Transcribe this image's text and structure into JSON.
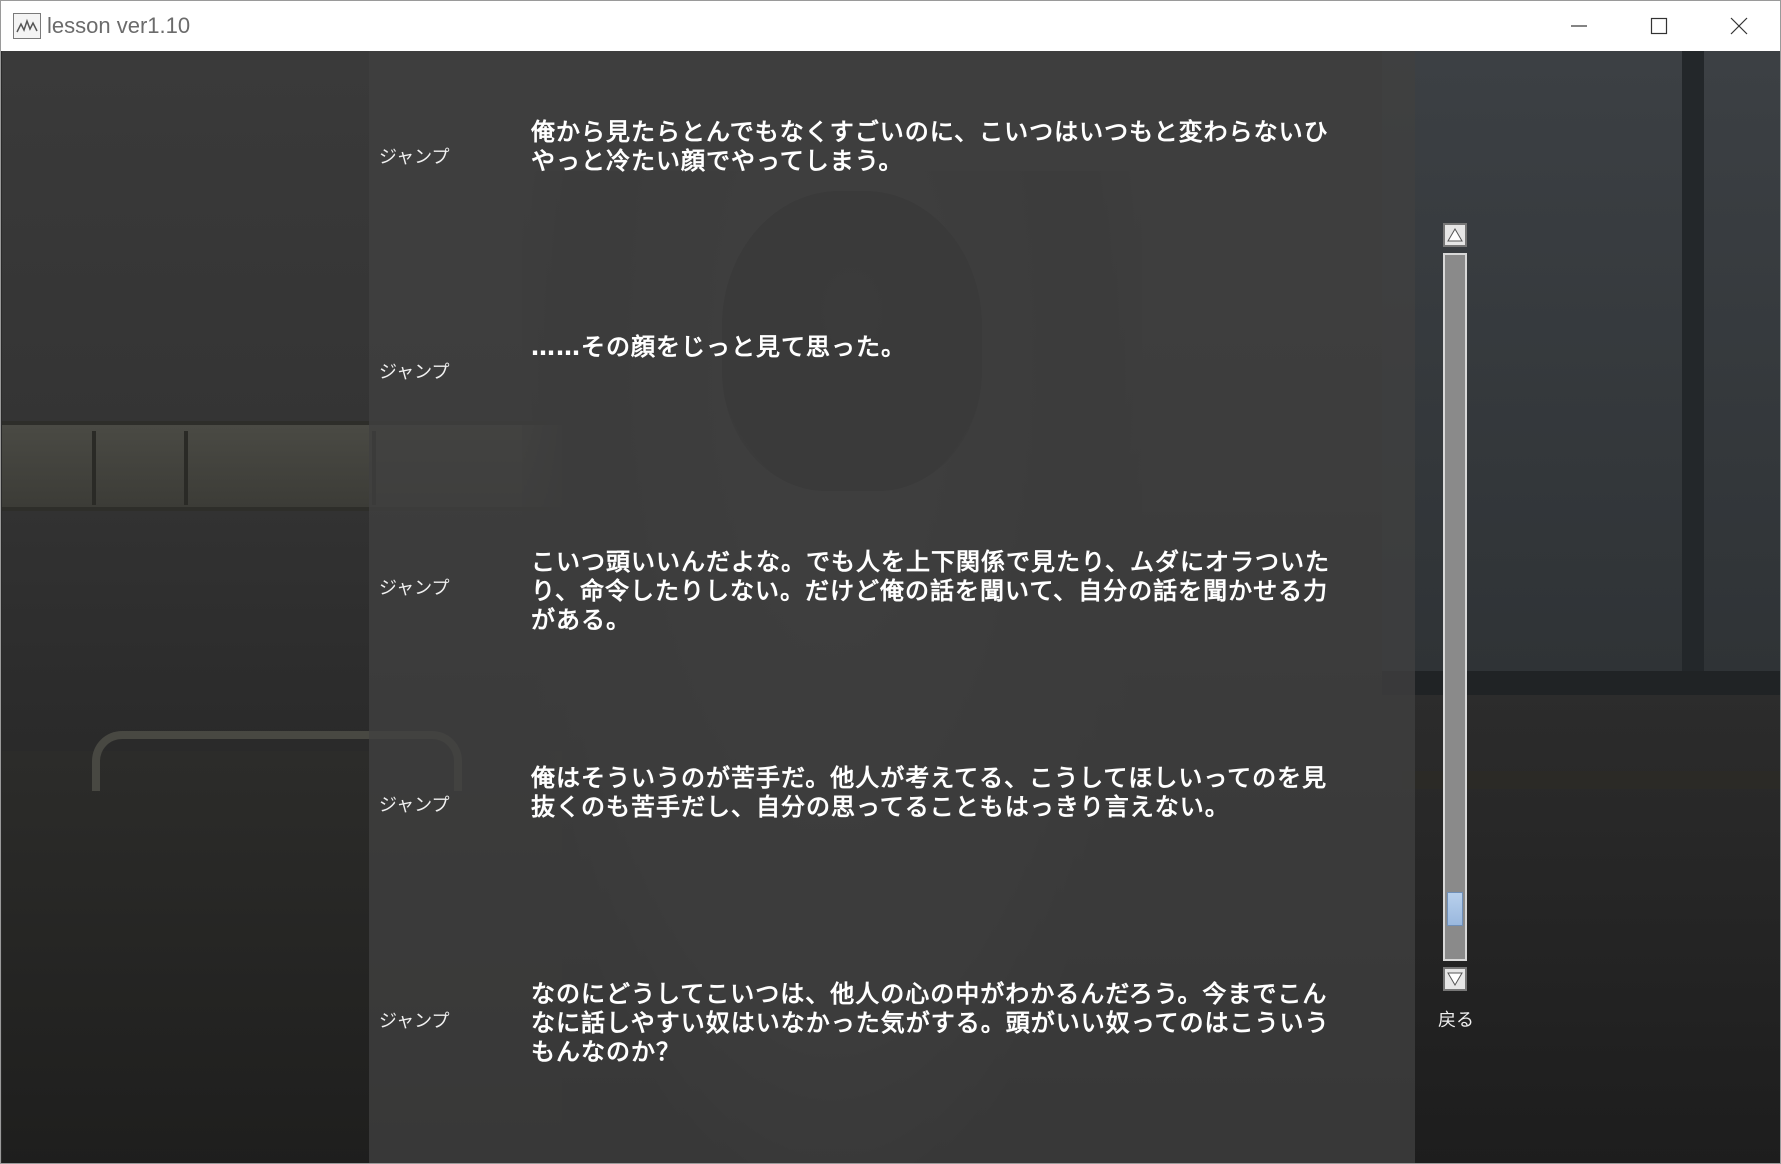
{
  "window": {
    "title": "lesson ver1.10",
    "controls": {
      "minimize_icon": "minimize-icon",
      "maximize_icon": "maximize-icon",
      "close_icon": "close-icon"
    }
  },
  "backlog": {
    "entries": [
      {
        "jump_label": "ジャンプ",
        "text": "俺から見たらとんでもなくすごいのに、こいつはいつもと変わらないひやっと冷たい顔でやってしまう。"
      },
      {
        "jump_label": "ジャンプ",
        "text": "……その顔をじっと見て思った。"
      },
      {
        "jump_label": "ジャンプ",
        "text": "こいつ頭いいんだよな。でも人を上下関係で見たり、ムダにオラついたり、命令したりしない。だけど俺の話を聞いて、自分の話を聞かせる力がある。"
      },
      {
        "jump_label": "ジャンプ",
        "text": "俺はそういうのが苦手だ。他人が考えてる、こうしてほしいってのを見抜くのも苦手だし、自分の思ってることもはっきり言えない。"
      },
      {
        "jump_label": "ジャンプ",
        "text": "なのにどうしてこいつは、他人の心の中がわかるんだろう。今までこんなに話しやすい奴はいなかった気がする。頭がいい奴ってのはこういうもんなのか？"
      }
    ],
    "scroll": {
      "position_fraction": 0.95
    },
    "back_label": "戻る"
  },
  "colors": {
    "panel": "#404040",
    "text": "#ffffff",
    "scroll_thumb": "#9ab8de"
  }
}
